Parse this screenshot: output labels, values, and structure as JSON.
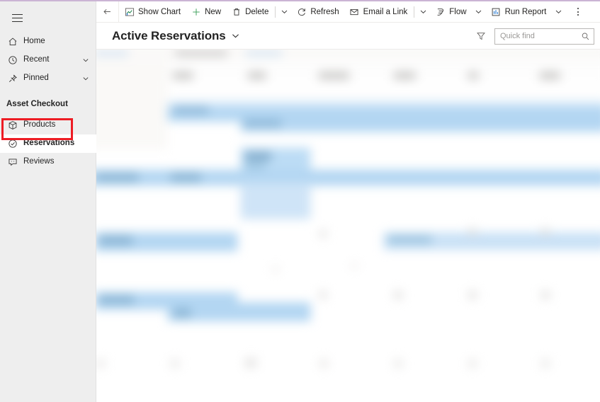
{
  "window": {
    "accent_color": "#cbb4d4",
    "background": "#ffffff"
  },
  "sidebar": {
    "hamburger_label": "Site map",
    "items": [
      {
        "label": "Home",
        "icon": "home-icon",
        "has_chevron": false,
        "selected": false
      },
      {
        "label": "Recent",
        "icon": "clock-icon",
        "has_chevron": true,
        "selected": false
      },
      {
        "label": "Pinned",
        "icon": "pin-icon",
        "has_chevron": true,
        "selected": false
      }
    ],
    "group": {
      "title": "Asset Checkout",
      "items": [
        {
          "label": "Products",
          "icon": "box-icon",
          "selected": false
        },
        {
          "label": "Reservations",
          "icon": "check-circle-icon",
          "selected": true
        },
        {
          "label": "Reviews",
          "icon": "comment-icon",
          "selected": false
        }
      ]
    },
    "highlight": {
      "target": "Reservations",
      "color": "#ed1c24"
    }
  },
  "commandbar": {
    "back_label": "Back",
    "commands": [
      {
        "label": "Show Chart",
        "icon": "chart-icon",
        "caret": false
      },
      {
        "label": "New",
        "icon": "plus-icon",
        "caret": false
      },
      {
        "label": "Delete",
        "icon": "trash-icon",
        "caret": true
      },
      {
        "label": "Refresh",
        "icon": "refresh-icon",
        "caret": false
      },
      {
        "label": "Email a Link",
        "icon": "email-icon",
        "caret": true
      },
      {
        "label": "Flow",
        "icon": "flow-icon",
        "caret": true
      },
      {
        "label": "Run Report",
        "icon": "report-icon",
        "caret": true
      }
    ],
    "overflow_label": "More commands"
  },
  "viewbar": {
    "title": "Active Reservations",
    "title_chevron": "chevron-down-icon",
    "filter_label": "Filter",
    "search": {
      "placeholder": "Quick find",
      "value": "",
      "icon": "search-icon"
    }
  },
  "grid": {
    "state": "blurred",
    "description": "Reservations list view content is visually obscured",
    "selection_color": "#b3d6f2"
  }
}
